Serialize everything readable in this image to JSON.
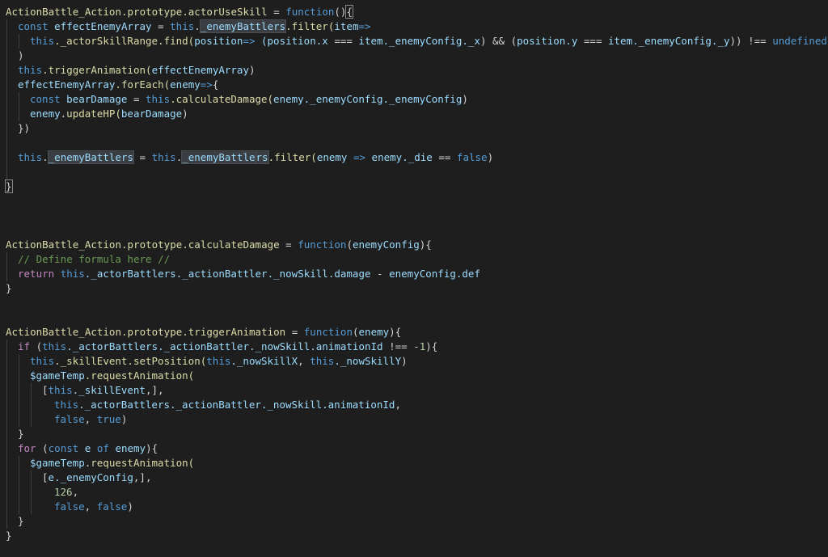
{
  "editor": {
    "theme_background": "#1e1e1e",
    "lines": [
      {
        "indent": 0,
        "tokens": [
          {
            "t": "ActionBattle_Action.prototype.actorUseSkill",
            "c": "fn"
          },
          {
            "t": " = ",
            "c": "op"
          },
          {
            "t": "function",
            "c": "kw"
          },
          {
            "t": "()",
            "c": "op"
          },
          {
            "t": "{",
            "c": "op",
            "mark": "bracket"
          }
        ]
      },
      {
        "indent": 1,
        "tokens": [
          {
            "t": "const ",
            "c": "kw"
          },
          {
            "t": "effectEnemyArray",
            "c": "var"
          },
          {
            "t": " = ",
            "c": "op"
          },
          {
            "t": "this",
            "c": "kw"
          },
          {
            "t": ".",
            "c": "op"
          },
          {
            "t": "_enemyBattlers",
            "c": "var",
            "mark": "hl"
          },
          {
            "t": ".filter(",
            "c": "fn"
          },
          {
            "t": "item",
            "c": "var"
          },
          {
            "t": "=>",
            "c": "kw"
          }
        ]
      },
      {
        "indent": 2,
        "tokens": [
          {
            "t": "this",
            "c": "kw"
          },
          {
            "t": "._actorSkillRange.find(",
            "c": "fn"
          },
          {
            "t": "position",
            "c": "var"
          },
          {
            "t": "=> ",
            "c": "kw"
          },
          {
            "t": "(position.x ",
            "c": "var"
          },
          {
            "t": "=== ",
            "c": "op"
          },
          {
            "t": "item._enemyConfig._x",
            "c": "var"
          },
          {
            "t": ") && (",
            "c": "op"
          },
          {
            "t": "position.y ",
            "c": "var"
          },
          {
            "t": "=== ",
            "c": "op"
          },
          {
            "t": "item._enemyConfig._y",
            "c": "var"
          },
          {
            "t": ")) !== ",
            "c": "op"
          },
          {
            "t": "undefined",
            "c": "kw"
          }
        ]
      },
      {
        "indent": 1,
        "tokens": [
          {
            "t": ")",
            "c": "op"
          }
        ]
      },
      {
        "indent": 1,
        "tokens": [
          {
            "t": "this",
            "c": "kw"
          },
          {
            "t": ".triggerAnimation(",
            "c": "fn"
          },
          {
            "t": "effectEnemyArray",
            "c": "var"
          },
          {
            "t": ")",
            "c": "op"
          }
        ]
      },
      {
        "indent": 1,
        "tokens": [
          {
            "t": "effectEnemyArray",
            "c": "var"
          },
          {
            "t": ".forEach(",
            "c": "fn"
          },
          {
            "t": "enemy",
            "c": "var"
          },
          {
            "t": "=>",
            "c": "kw"
          },
          {
            "t": "{",
            "c": "op"
          }
        ]
      },
      {
        "indent": 2,
        "tokens": [
          {
            "t": "const ",
            "c": "kw"
          },
          {
            "t": "bearDamage",
            "c": "var"
          },
          {
            "t": " = ",
            "c": "op"
          },
          {
            "t": "this",
            "c": "kw"
          },
          {
            "t": ".calculateDamage(",
            "c": "fn"
          },
          {
            "t": "enemy._enemyConfig._enemyConfig",
            "c": "var"
          },
          {
            "t": ")",
            "c": "op"
          }
        ]
      },
      {
        "indent": 2,
        "tokens": [
          {
            "t": "enemy",
            "c": "var"
          },
          {
            "t": ".updateHP(",
            "c": "fn"
          },
          {
            "t": "bearDamage",
            "c": "var"
          },
          {
            "t": ")",
            "c": "op"
          }
        ]
      },
      {
        "indent": 1,
        "tokens": [
          {
            "t": "})",
            "c": "op"
          }
        ]
      },
      {
        "indent": 0,
        "guides": 1,
        "tokens": []
      },
      {
        "indent": 1,
        "tokens": [
          {
            "t": "this",
            "c": "kw"
          },
          {
            "t": ".",
            "c": "op"
          },
          {
            "t": "_enemyBattlers",
            "c": "var",
            "mark": "hl"
          },
          {
            "t": " = ",
            "c": "op"
          },
          {
            "t": "this",
            "c": "kw"
          },
          {
            "t": ".",
            "c": "op"
          },
          {
            "t": "_enemyBattle",
            "c": "var",
            "mark": "hl"
          },
          {
            "t": "",
            "c": "op",
            "mark": "cursor"
          },
          {
            "t": "rs",
            "c": "var",
            "mark": "hl"
          },
          {
            "t": ".filter(",
            "c": "fn"
          },
          {
            "t": "enemy ",
            "c": "var"
          },
          {
            "t": "=> ",
            "c": "kw"
          },
          {
            "t": "enemy._die ",
            "c": "var"
          },
          {
            "t": "== ",
            "c": "op"
          },
          {
            "t": "false",
            "c": "kw"
          },
          {
            "t": ")",
            "c": "op"
          }
        ]
      },
      {
        "indent": 0,
        "guides": 1,
        "tokens": []
      },
      {
        "indent": 0,
        "tokens": [
          {
            "t": "}",
            "c": "op",
            "mark": "bracket"
          }
        ]
      },
      {
        "indent": 0,
        "tokens": []
      },
      {
        "indent": 0,
        "tokens": []
      },
      {
        "indent": 0,
        "tokens": []
      },
      {
        "indent": 0,
        "tokens": [
          {
            "t": "ActionBattle_Action.prototype.calculateDamage",
            "c": "fn"
          },
          {
            "t": " = ",
            "c": "op"
          },
          {
            "t": "function",
            "c": "kw"
          },
          {
            "t": "(",
            "c": "op"
          },
          {
            "t": "enemyConfig",
            "c": "var"
          },
          {
            "t": "){",
            "c": "op"
          }
        ]
      },
      {
        "indent": 1,
        "tokens": [
          {
            "t": "// Define formula here //",
            "c": "cmt"
          }
        ]
      },
      {
        "indent": 1,
        "tokens": [
          {
            "t": "return ",
            "c": "ctl"
          },
          {
            "t": "this",
            "c": "kw"
          },
          {
            "t": "._actorBattlers._actionBattler._nowSkill.damage",
            "c": "var"
          },
          {
            "t": " - ",
            "c": "op"
          },
          {
            "t": "enemyConfig.def",
            "c": "var"
          }
        ]
      },
      {
        "indent": 0,
        "tokens": [
          {
            "t": "}",
            "c": "op"
          }
        ]
      },
      {
        "indent": 0,
        "tokens": []
      },
      {
        "indent": 0,
        "tokens": []
      },
      {
        "indent": 0,
        "tokens": [
          {
            "t": "ActionBattle_Action.prototype.triggerAnimation",
            "c": "fn"
          },
          {
            "t": " = ",
            "c": "op"
          },
          {
            "t": "function",
            "c": "kw"
          },
          {
            "t": "(",
            "c": "op"
          },
          {
            "t": "enemy",
            "c": "var"
          },
          {
            "t": "){",
            "c": "op"
          }
        ]
      },
      {
        "indent": 1,
        "tokens": [
          {
            "t": "if ",
            "c": "ctl"
          },
          {
            "t": "(",
            "c": "op"
          },
          {
            "t": "this",
            "c": "kw"
          },
          {
            "t": "._actorBattlers._actionBattler._nowSkill.animationId",
            "c": "var"
          },
          {
            "t": " !== ",
            "c": "op"
          },
          {
            "t": "-1",
            "c": "num"
          },
          {
            "t": "){",
            "c": "op"
          }
        ]
      },
      {
        "indent": 2,
        "tokens": [
          {
            "t": "this",
            "c": "kw"
          },
          {
            "t": "._skillEvent.setPosition(",
            "c": "fn"
          },
          {
            "t": "this",
            "c": "kw"
          },
          {
            "t": "._nowSkillX",
            "c": "var"
          },
          {
            "t": ", ",
            "c": "op"
          },
          {
            "t": "this",
            "c": "kw"
          },
          {
            "t": "._nowSkillY",
            "c": "var"
          },
          {
            "t": ")",
            "c": "op"
          }
        ]
      },
      {
        "indent": 2,
        "tokens": [
          {
            "t": "$gameTemp",
            "c": "var"
          },
          {
            "t": ".requestAnimation(",
            "c": "fn"
          }
        ]
      },
      {
        "indent": 3,
        "tokens": [
          {
            "t": "[",
            "c": "op"
          },
          {
            "t": "this",
            "c": "kw"
          },
          {
            "t": "._skillEvent",
            "c": "var"
          },
          {
            "t": ",],",
            "c": "op"
          }
        ]
      },
      {
        "indent": 3,
        "extra": 1,
        "tokens": [
          {
            "t": "this",
            "c": "kw"
          },
          {
            "t": "._actorBattlers._actionBattler._nowSkill.animationId",
            "c": "var"
          },
          {
            "t": ",",
            "c": "op"
          }
        ]
      },
      {
        "indent": 3,
        "extra": 1,
        "tokens": [
          {
            "t": "false",
            "c": "kw"
          },
          {
            "t": ", ",
            "c": "op"
          },
          {
            "t": "true",
            "c": "kw"
          },
          {
            "t": ")",
            "c": "op"
          }
        ]
      },
      {
        "indent": 1,
        "tokens": [
          {
            "t": "}",
            "c": "op"
          }
        ]
      },
      {
        "indent": 1,
        "tokens": [
          {
            "t": "for ",
            "c": "ctl"
          },
          {
            "t": "(",
            "c": "op"
          },
          {
            "t": "const ",
            "c": "kw"
          },
          {
            "t": "e ",
            "c": "var"
          },
          {
            "t": "of ",
            "c": "kw"
          },
          {
            "t": "enemy",
            "c": "var"
          },
          {
            "t": "){",
            "c": "op"
          }
        ]
      },
      {
        "indent": 2,
        "tokens": [
          {
            "t": "$gameTemp",
            "c": "var"
          },
          {
            "t": ".requestAnimation(",
            "c": "fn"
          }
        ]
      },
      {
        "indent": 3,
        "tokens": [
          {
            "t": "[",
            "c": "op"
          },
          {
            "t": "e._enemyConfig",
            "c": "var"
          },
          {
            "t": ",],",
            "c": "op"
          }
        ]
      },
      {
        "indent": 3,
        "extra": 1,
        "tokens": [
          {
            "t": "126",
            "c": "num"
          },
          {
            "t": ",",
            "c": "op"
          }
        ]
      },
      {
        "indent": 3,
        "extra": 1,
        "tokens": [
          {
            "t": "false",
            "c": "kw"
          },
          {
            "t": ", ",
            "c": "op"
          },
          {
            "t": "false",
            "c": "kw"
          },
          {
            "t": ")",
            "c": "op"
          }
        ]
      },
      {
        "indent": 1,
        "tokens": [
          {
            "t": "}",
            "c": "op"
          }
        ]
      },
      {
        "indent": 0,
        "tokens": [
          {
            "t": "}",
            "c": "op"
          }
        ]
      }
    ]
  }
}
